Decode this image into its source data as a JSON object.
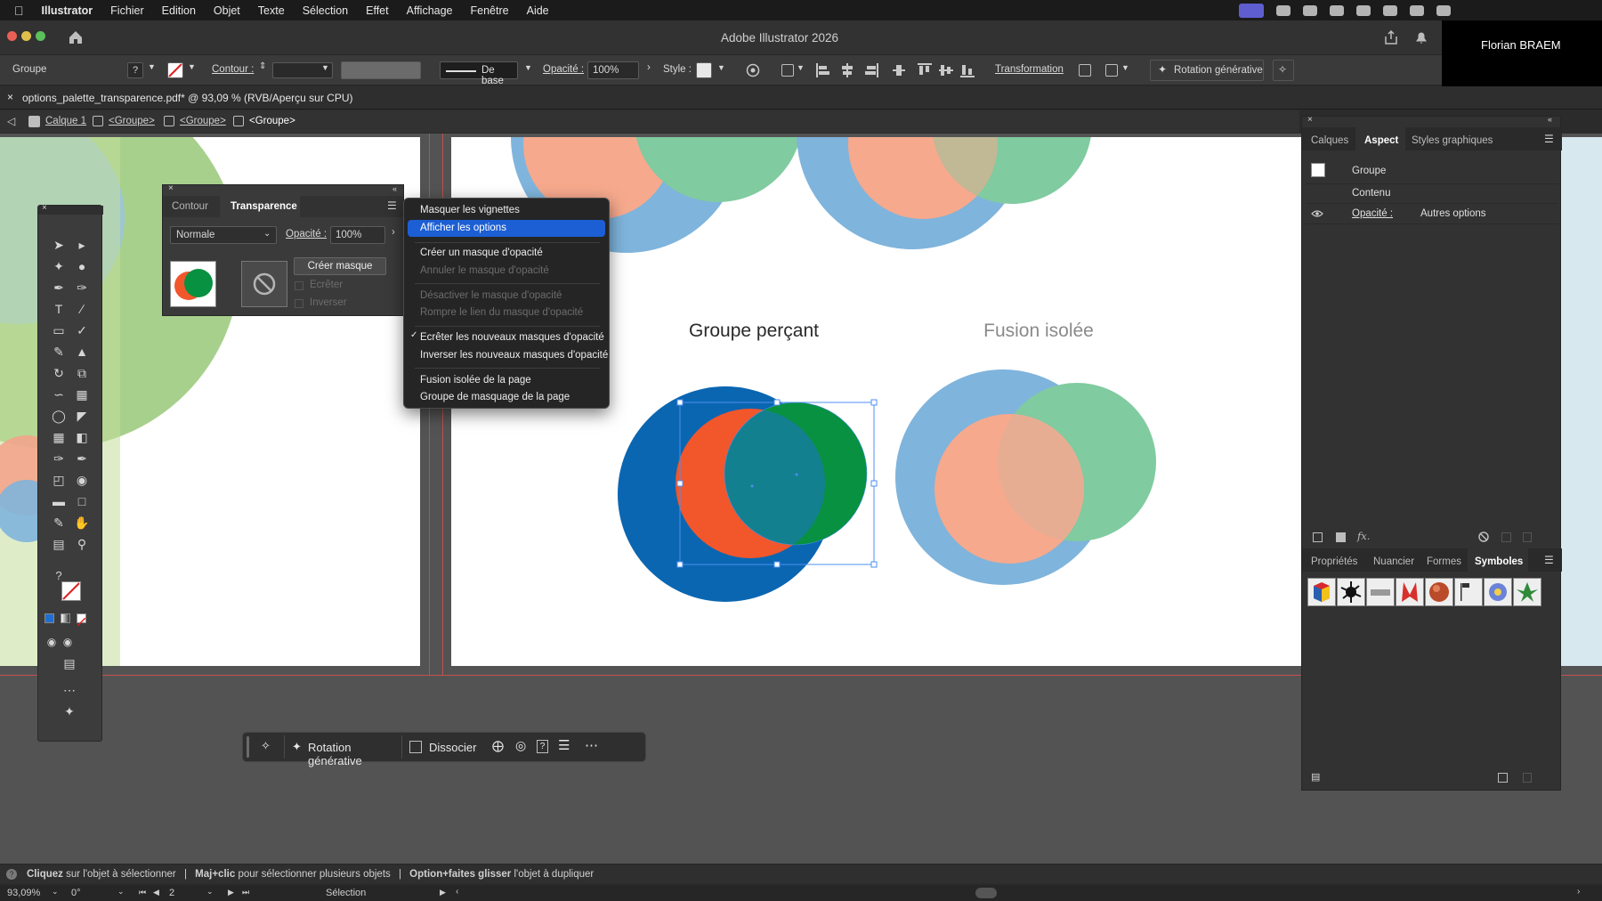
{
  "menubar": {
    "app_name": "Illustrator",
    "items": [
      "Fichier",
      "Edition",
      "Objet",
      "Texte",
      "Sélection",
      "Effet",
      "Affichage",
      "Fenêtre",
      "Aide"
    ]
  },
  "window": {
    "title": "Adobe Illustrator 2026",
    "user": "Florian BRAEM"
  },
  "control_bar": {
    "selection_type": "Groupe",
    "stroke_label": "Contour :",
    "brush_label": "De base",
    "opacity_label": "Opacité :",
    "opacity_value": "100%",
    "style_label": "Style :",
    "transform_label": "Transformation",
    "generative_label": "Rotation générative"
  },
  "document": {
    "tab_label": "options_palette_transparence.pdf* @ 93,09 % (RVB/Aperçu sur CPU)",
    "breadcrumb": [
      "Calque 1",
      "<Groupe>",
      "<Groupe>",
      "<Groupe>"
    ]
  },
  "artwork": {
    "label_left": "Groupe perçant",
    "label_right": "Fusion isolée"
  },
  "transparency_panel": {
    "tab_stroke": "Contour",
    "tab_transparency": "Transparence",
    "blend_mode": "Normale",
    "opacity_label": "Opacité :",
    "opacity_value": "100%",
    "make_mask": "Créer masque",
    "clip": "Ecrêter",
    "invert": "Inverser"
  },
  "context_menu": {
    "items": [
      {
        "label": "Masquer les vignettes",
        "state": "normal"
      },
      {
        "label": "Afficher les options",
        "state": "highlighted"
      },
      {
        "label": "Créer un masque d'opacité",
        "state": "normal"
      },
      {
        "label": "Annuler le masque d'opacité",
        "state": "disabled"
      },
      {
        "label": "Désactiver le masque d'opacité",
        "state": "disabled"
      },
      {
        "label": "Rompre le lien du masque d'opacité",
        "state": "disabled"
      },
      {
        "label": "Ecrêter les nouveaux masques d'opacité",
        "state": "checked"
      },
      {
        "label": "Inverser les nouveaux masques d'opacité",
        "state": "normal"
      },
      {
        "label": "Fusion isolée de la page",
        "state": "normal"
      },
      {
        "label": "Groupe de masquage de la page",
        "state": "normal"
      }
    ]
  },
  "appearance_panel": {
    "tabs": [
      "Calques",
      "Aspect",
      "Styles graphiques"
    ],
    "active_tab": "Aspect",
    "group_label": "Groupe",
    "content_label": "Contenu",
    "opacity_label": "Opacité :",
    "opacity_value": "Autres options"
  },
  "symbols_panel": {
    "tabs": [
      "Propriétés",
      "Nuancier",
      "Formes",
      "Symboles"
    ],
    "active_tab": "Symboles"
  },
  "task_bar": {
    "generative_label": "Rotation générative",
    "ungroup_label": "Dissocier"
  },
  "status_bar": {
    "hint_1_bold": "Cliquez",
    "hint_1": "sur l'objet à sélectionner",
    "hint_2_bold": "Maj+clic",
    "hint_2": "pour sélectionner plusieurs objets",
    "hint_3_bold": "Option+faites glisser",
    "hint_3": "l'objet à dupliquer"
  },
  "zoom_bar": {
    "zoom": "93,09%",
    "rotation": "0°",
    "artboard": "2",
    "tool": "Sélection"
  },
  "colors": {
    "accent": "#1c5fd4",
    "light_blue": "#7fb4dc",
    "salmon": "#f6a98d",
    "mint": "#80cba0",
    "deep_blue": "#0a66b1",
    "orange_red": "#f2562b",
    "green": "#089141",
    "teal": "#13808f"
  }
}
